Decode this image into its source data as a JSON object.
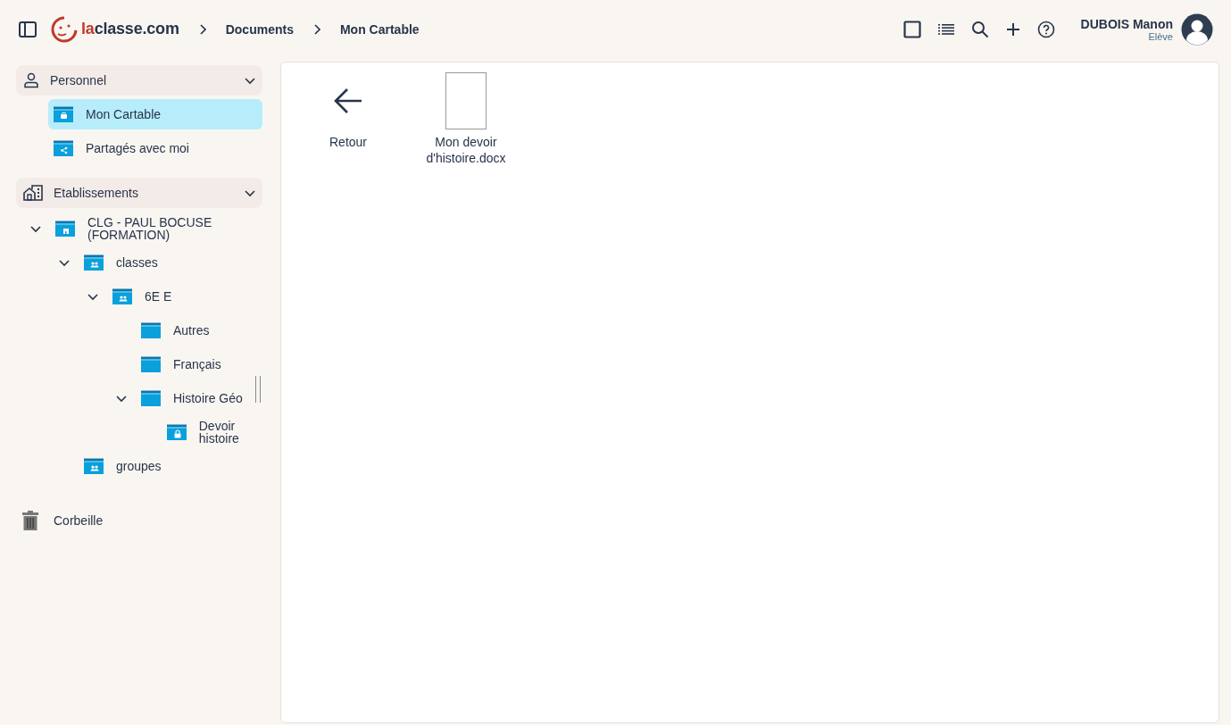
{
  "header": {
    "logo": {
      "accent": "la",
      "rest": "classe.com"
    },
    "breadcrumbs": [
      {
        "label": "Documents"
      },
      {
        "label": "Mon Cartable"
      }
    ],
    "user": {
      "name": "DUBOIS Manon",
      "role": "Elève"
    }
  },
  "sidebar": {
    "sections": [
      {
        "label": "Personnel",
        "kind": "person",
        "expanded": true,
        "items": [
          {
            "label": "Mon Cartable",
            "kind": "briefcase",
            "selected": true
          },
          {
            "label": "Partagés avec moi",
            "kind": "share",
            "selected": false
          }
        ]
      },
      {
        "label": "Etablissements",
        "kind": "building",
        "expanded": true,
        "tree": [
          {
            "label": "CLG - PAUL BOCUSE (FORMATION)",
            "kind": "school",
            "expanded": true,
            "children": [
              {
                "label": "classes",
                "kind": "group",
                "expanded": true,
                "children": [
                  {
                    "label": "6E E",
                    "kind": "group",
                    "expanded": true,
                    "children": [
                      {
                        "label": "Autres",
                        "kind": "plain",
                        "expanded": false
                      },
                      {
                        "label": "Français",
                        "kind": "plain",
                        "expanded": false
                      },
                      {
                        "label": "Histoire Géo",
                        "kind": "plain",
                        "expanded": true,
                        "children": [
                          {
                            "label": "Devoir histoire",
                            "kind": "lock",
                            "expanded": false
                          }
                        ]
                      }
                    ]
                  }
                ]
              },
              {
                "label": "groupes",
                "kind": "group",
                "expanded": false
              }
            ]
          }
        ]
      }
    ],
    "trash": {
      "label": "Corbeille"
    }
  },
  "content": {
    "items": [
      {
        "kind": "back",
        "label": "Retour"
      },
      {
        "kind": "file",
        "label": "Mon devoir d'histoire.docx"
      }
    ]
  }
}
